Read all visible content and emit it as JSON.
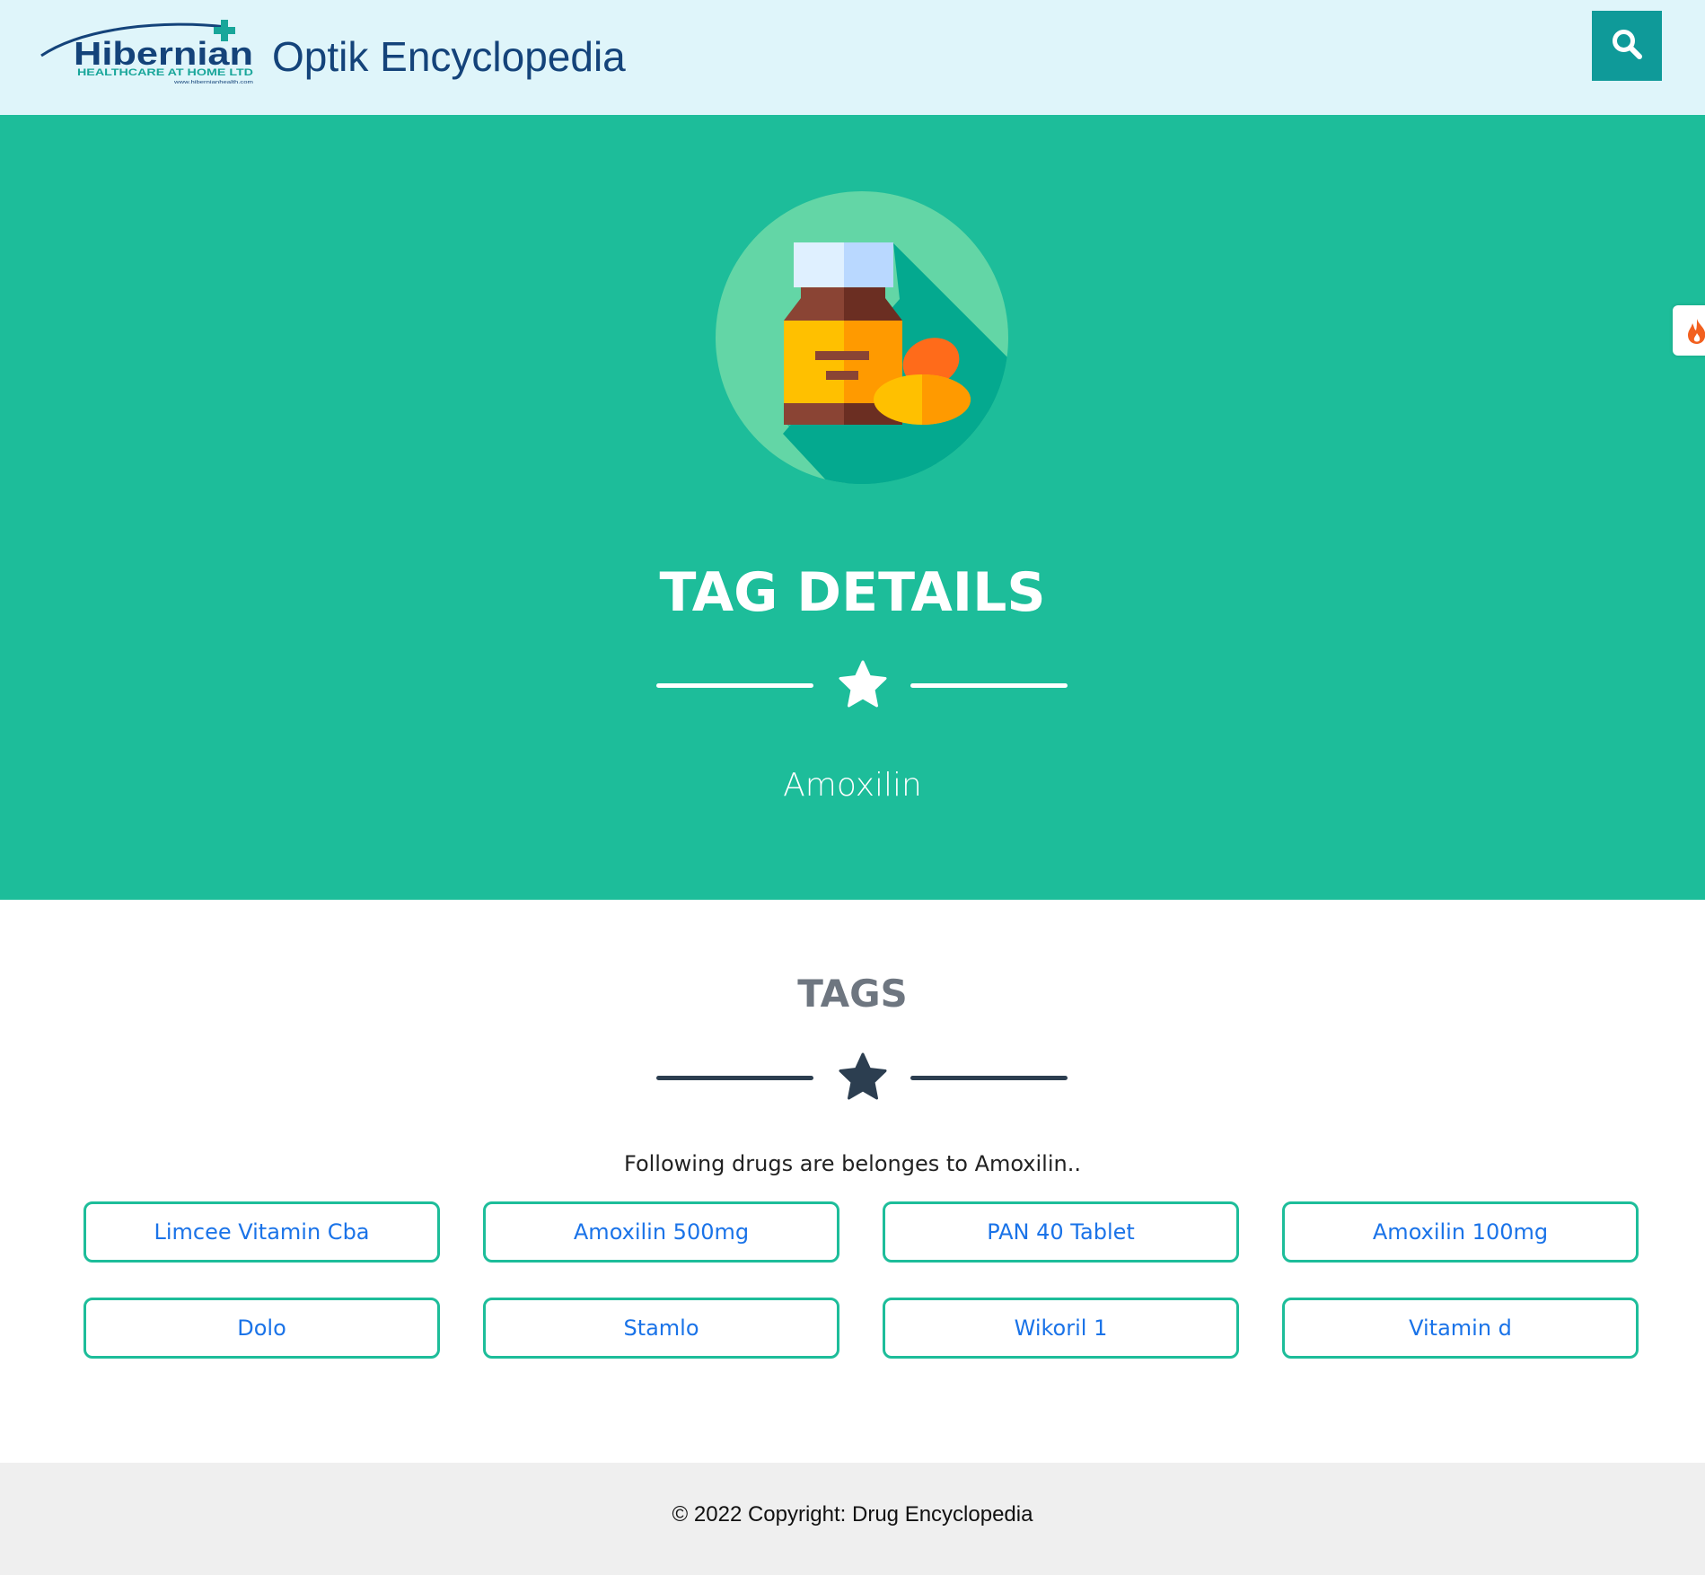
{
  "header": {
    "logo": {
      "name": "Hibernian",
      "tagline": "HEALTHCARE AT HOME LTD",
      "url_small": "www.hibernianhealth.com"
    },
    "site_title": "Optik Encyclopedia",
    "search_icon": "search-icon",
    "background_color": "#dff5fa",
    "button_color": "#0f9a99"
  },
  "hero": {
    "icon": "medicine-bottle-icon",
    "title": "TAG DETAILS",
    "divider_icon": "star-icon",
    "subtitle": "Amoxilin",
    "background_color": "#1dbd9a"
  },
  "side_tab": {
    "icon": "flame-icon"
  },
  "tags_section": {
    "title": "TAGS",
    "divider_icon": "star-icon",
    "description": "Following drugs are belonges to Amoxilin..",
    "tags": [
      {
        "label": "Limcee Vitamin Cba"
      },
      {
        "label": "Amoxilin 500mg"
      },
      {
        "label": "PAN 40 Tablet"
      },
      {
        "label": "Amoxilin 100mg"
      },
      {
        "label": "Dolo"
      },
      {
        "label": "Stamlo"
      },
      {
        "label": "Wikoril 1"
      },
      {
        "label": "Vitamin d"
      }
    ],
    "tag_border_color": "#1dbd9a",
    "tag_text_color": "#1a73e8"
  },
  "footer": {
    "copyright": "© 2022 Copyright: Drug Encyclopedia"
  }
}
